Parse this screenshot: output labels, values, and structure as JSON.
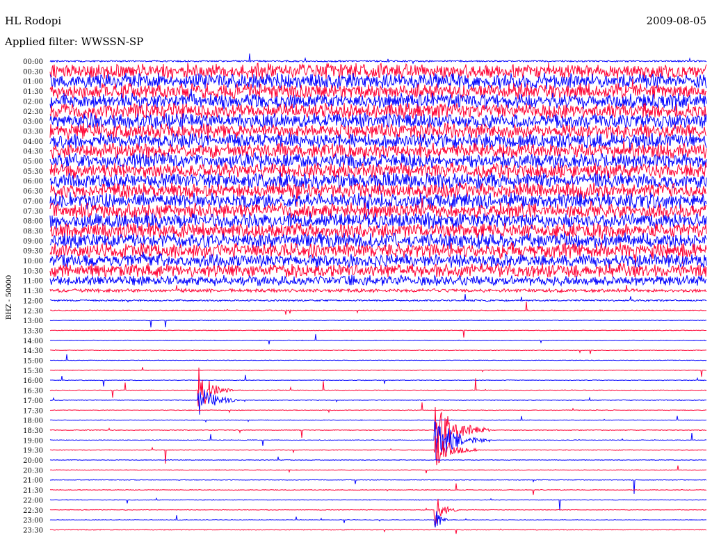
{
  "header": {
    "station": "HL Rodopi",
    "date": "2009-08-05",
    "filter_label": "Applied filter: WWSSN-SP"
  },
  "chart_data": {
    "type": "helicorder",
    "title": "HL Rodopi",
    "date": "2009-08-05",
    "filter": "WWSSN-SP",
    "channel_label": "BHZ - 50000",
    "colors": {
      "blue": "#0000ff",
      "red": "#ff0033",
      "background": "#ffffff"
    },
    "row_labels": [
      "00:00",
      "00:30",
      "01:00",
      "01:30",
      "02:00",
      "02:30",
      "03:00",
      "03:30",
      "04:00",
      "04:30",
      "05:00",
      "05:30",
      "06:00",
      "06:30",
      "07:00",
      "07:30",
      "08:00",
      "08:30",
      "09:00",
      "09:30",
      "10:00",
      "10:30",
      "11:00",
      "11:30",
      "12:00",
      "12:30",
      "13:00",
      "13:30",
      "14:00",
      "14:30",
      "15:00",
      "15:30",
      "16:00",
      "16:30",
      "17:00",
      "17:30",
      "18:00",
      "18:30",
      "19:00",
      "19:30",
      "20:00",
      "20:30",
      "21:00",
      "21:30",
      "22:00",
      "22:30",
      "23:00",
      "23:30"
    ],
    "row_colors": "alternating blue/red starting with blue",
    "trace_minutes_per_row": 30,
    "noise_level": [
      1,
      9,
      9,
      9,
      9,
      9,
      9,
      9,
      9,
      9,
      9,
      9,
      9,
      9,
      9,
      9,
      9,
      9,
      9,
      9,
      8,
      8,
      6,
      2,
      1,
      0.6,
      0.4,
      0.4,
      0.4,
      0.4,
      0.4,
      0.4,
      0.4,
      0.4,
      0.4,
      0.4,
      0.4,
      0.4,
      0.4,
      0.4,
      0.4,
      0.4,
      0.4,
      0.4,
      0.4,
      0.4,
      0.4,
      0.4
    ],
    "events": [
      {
        "row": "16:30",
        "position": 0.23,
        "amplitude": 3.5,
        "duration": 0.05
      },
      {
        "row": "17:00",
        "position": 0.23,
        "amplitude": 2.5,
        "duration": 0.06
      },
      {
        "row": "18:30",
        "position": 0.59,
        "amplitude": 5,
        "duration": 0.08
      },
      {
        "row": "19:00",
        "position": 0.59,
        "amplitude": 4,
        "duration": 0.08
      },
      {
        "row": "19:30",
        "position": 0.59,
        "amplitude": 3,
        "duration": 0.06
      },
      {
        "row": "22:30",
        "position": 0.59,
        "amplitude": 2.5,
        "duration": 0.03
      },
      {
        "row": "23:00",
        "position": 0.59,
        "amplitude": 1.5,
        "duration": 0.02
      }
    ]
  }
}
